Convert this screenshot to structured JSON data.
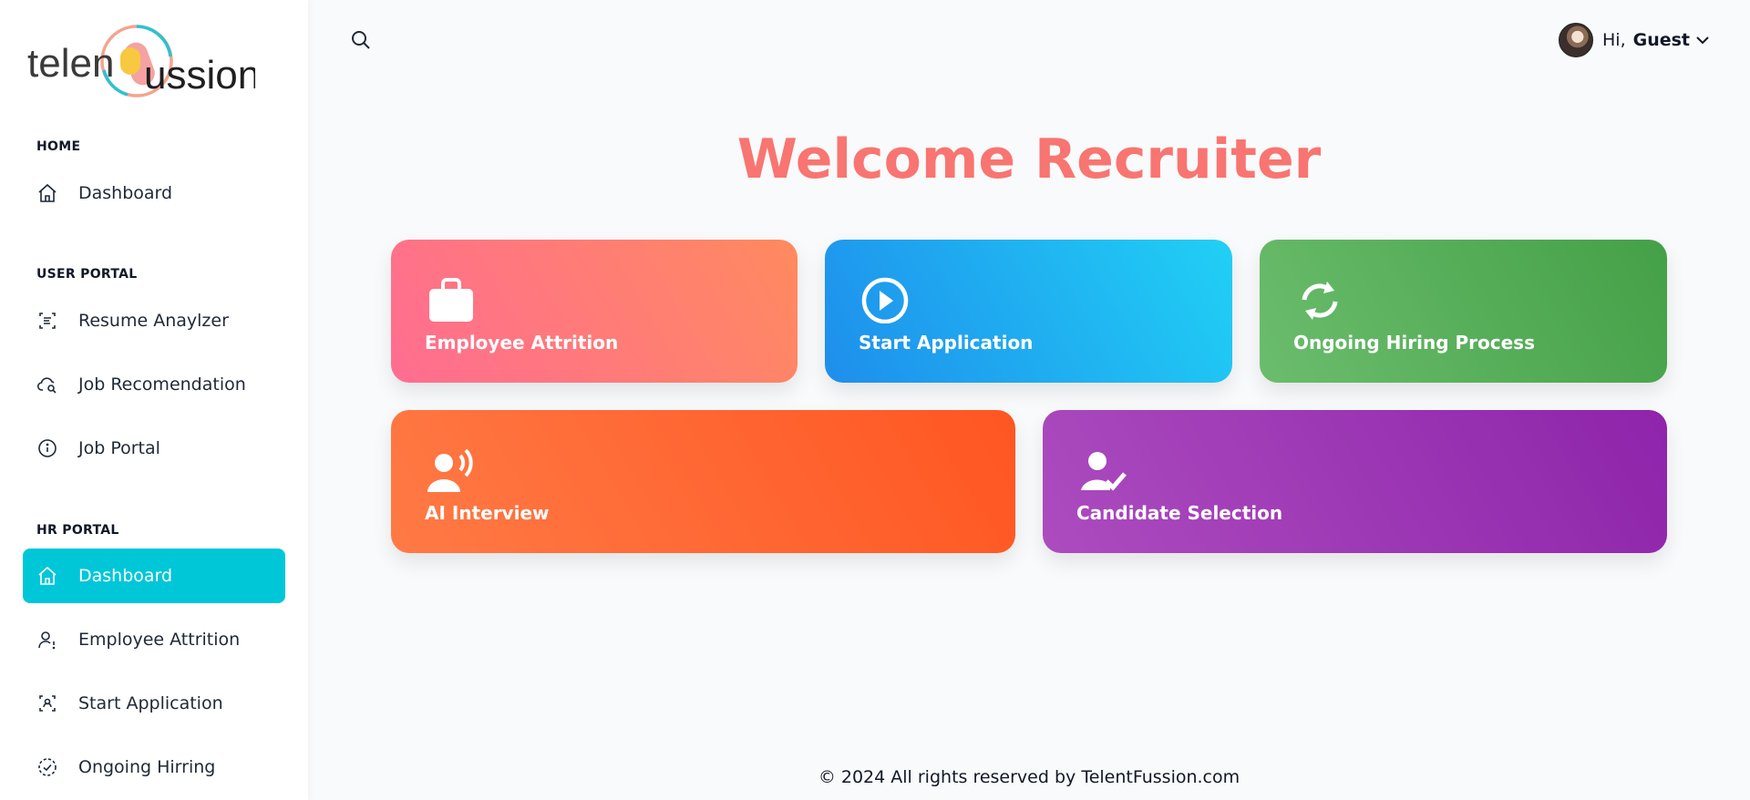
{
  "brand": {
    "logo_text_left": "telen",
    "logo_text_right": "ussion"
  },
  "sidebar": {
    "sections": [
      {
        "label": "HOME"
      },
      {
        "label": "USER PORTAL"
      },
      {
        "label": "HR PORTAL"
      }
    ],
    "items": [
      {
        "label": "Dashboard",
        "icon": "home-icon"
      },
      {
        "label": "Resume Anaylzer",
        "icon": "scan-text-icon"
      },
      {
        "label": "Job Recomendation",
        "icon": "cloud-search-icon"
      },
      {
        "label": "Job Portal",
        "icon": "info-icon"
      },
      {
        "label": "Dashboard",
        "icon": "home-icon",
        "active": true
      },
      {
        "label": "Employee Attrition",
        "icon": "user-alert-icon"
      },
      {
        "label": "Start Application",
        "icon": "scan-user-icon"
      },
      {
        "label": "Ongoing Hirring",
        "icon": "dashed-check-circle-icon"
      }
    ]
  },
  "header": {
    "search_icon": "search-icon",
    "greeting": "Hi,",
    "user_name": "Guest",
    "dropdown_icon": "chevron-down-icon"
  },
  "main": {
    "title": "Welcome Recruiter",
    "cards": [
      {
        "title": "Employee Attrition",
        "icon": "briefcase-icon"
      },
      {
        "title": "Start Application",
        "icon": "play-circle-icon"
      },
      {
        "title": "Ongoing Hiring Process",
        "icon": "refresh-icon"
      },
      {
        "title": "AI Interview",
        "icon": "user-voice-icon"
      },
      {
        "title": "Candidate Selection",
        "icon": "user-check-icon"
      }
    ]
  },
  "footer": {
    "text": "© 2024 All rights reserved by TelentFussion.com"
  },
  "colors": {
    "accent": "#00c7d8",
    "welcome": "#f87571"
  }
}
